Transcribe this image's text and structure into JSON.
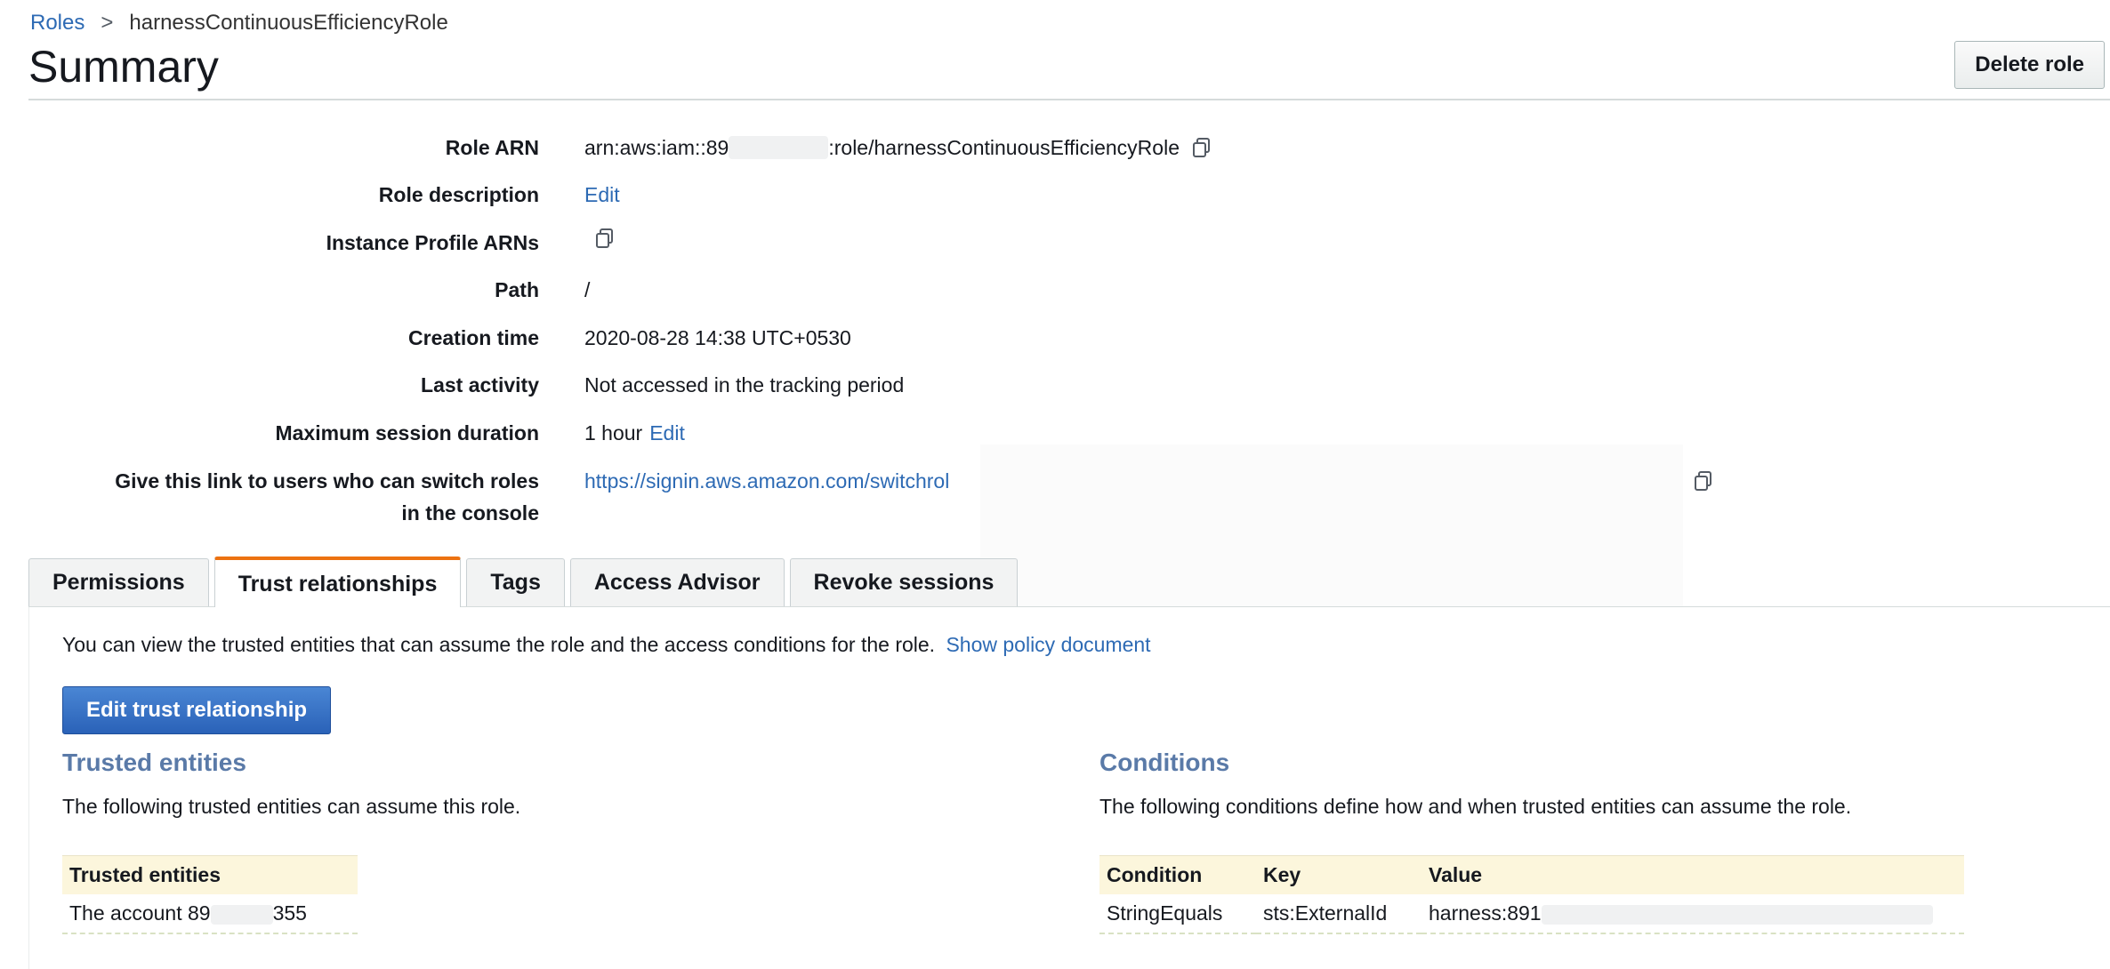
{
  "breadcrumb": {
    "root": "Roles",
    "separator": ">",
    "current": "harnessContinuousEfficiencyRole"
  },
  "page_title": "Summary",
  "header": {
    "delete_label": "Delete role"
  },
  "summary": {
    "role_arn": {
      "label": "Role ARN",
      "prefix": "arn:aws:iam::89",
      "suffix": ":role/harnessContinuousEfficiencyRole"
    },
    "role_description": {
      "label": "Role description",
      "edit": "Edit"
    },
    "instance_profile": {
      "label": "Instance Profile ARNs"
    },
    "path": {
      "label": "Path",
      "value": "/"
    },
    "creation_time": {
      "label": "Creation time",
      "value": "2020-08-28 14:38 UTC+0530"
    },
    "last_activity": {
      "label": "Last activity",
      "value": "Not accessed in the tracking period"
    },
    "max_session": {
      "label": "Maximum session duration",
      "value": "1 hour",
      "edit": "Edit"
    },
    "switch_link": {
      "label_line1": "Give this link to users who can switch roles",
      "label_line2": "in the console",
      "value": "https://signin.aws.amazon.com/switchrol"
    }
  },
  "tabs": [
    {
      "label": "Permissions",
      "active": false
    },
    {
      "label": "Trust relationships",
      "active": true
    },
    {
      "label": "Tags",
      "active": false
    },
    {
      "label": "Access Advisor",
      "active": false
    },
    {
      "label": "Revoke sessions",
      "active": false
    }
  ],
  "trust": {
    "intro": "You can view the trusted entities that can assume the role and the access conditions for the role.",
    "show_policy": "Show policy document",
    "edit_button": "Edit trust relationship",
    "trusted_title": "Trusted entities",
    "trusted_desc": "The following trusted entities can assume this role.",
    "trusted_header": "Trusted entities",
    "trusted_row_prefix": "The account 89",
    "trusted_row_suffix": "355",
    "conditions_title": "Conditions",
    "conditions_desc": "The following conditions define how and when trusted entities can assume the role.",
    "conditions_headers": [
      "Condition",
      "Key",
      "Value"
    ],
    "conditions_row": {
      "condition": "StringEquals",
      "key": "sts:ExternalId",
      "value_prefix": "harness:891"
    }
  }
}
